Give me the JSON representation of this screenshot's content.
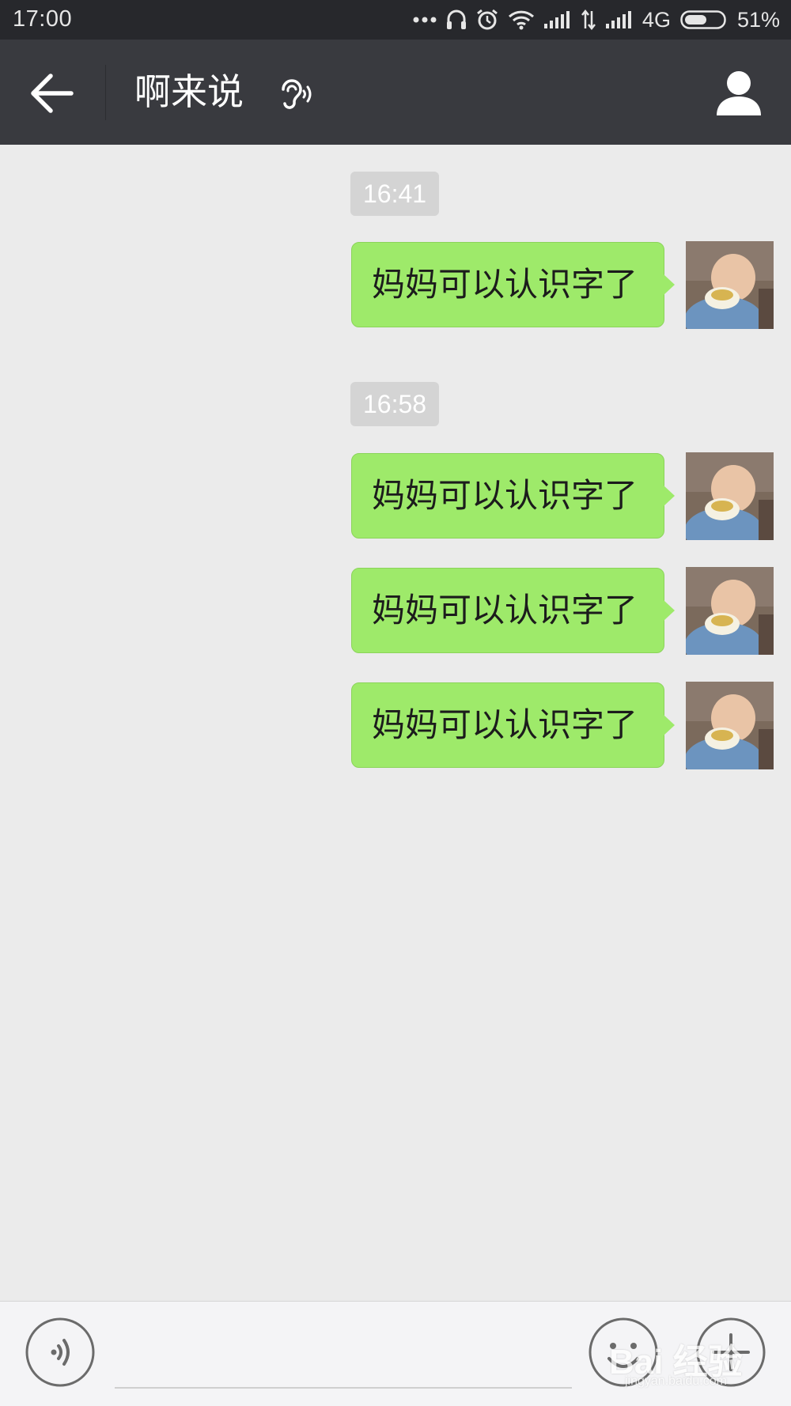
{
  "status_bar": {
    "time": "17:00",
    "network": "4G",
    "battery": "51%",
    "icons": [
      "more-dots-icon",
      "headphone-icon",
      "alarm-icon",
      "wifi-icon",
      "signal-icon",
      "data-arrows-icon",
      "signal-icon",
      "battery-icon"
    ]
  },
  "header": {
    "title": "啊来说",
    "icons": [
      "back-arrow-icon",
      "earpiece-icon",
      "person-icon"
    ]
  },
  "chat": {
    "groups": [
      {
        "time": "16:41",
        "messages": [
          "妈妈可以认识字了"
        ]
      },
      {
        "time": "16:58",
        "messages": [
          "妈妈可以认识字了",
          "妈妈可以认识字了",
          "妈妈可以认识字了"
        ]
      }
    ]
  },
  "input_bar": {
    "placeholder": "",
    "icons": [
      "voice-icon",
      "emoji-icon",
      "plus-icon"
    ]
  },
  "watermark": {
    "main": "Bai 经验",
    "sub": "jingyan.baidu.com"
  },
  "colors": {
    "status_bar_bg": "#27282c",
    "header_bg": "#393a3f",
    "chat_bg": "#ebebeb",
    "bubble_green": "#9eea6a",
    "time_pill": "#d4d4d4"
  }
}
